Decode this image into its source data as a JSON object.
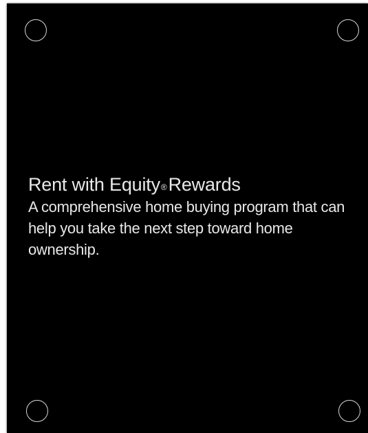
{
  "sign": {
    "title_main": "Rent with Equity",
    "title_mark": "®",
    "title_rest": "Rewards",
    "description": "A comprehensive home buying program that can help you take the next step toward home ownership."
  }
}
